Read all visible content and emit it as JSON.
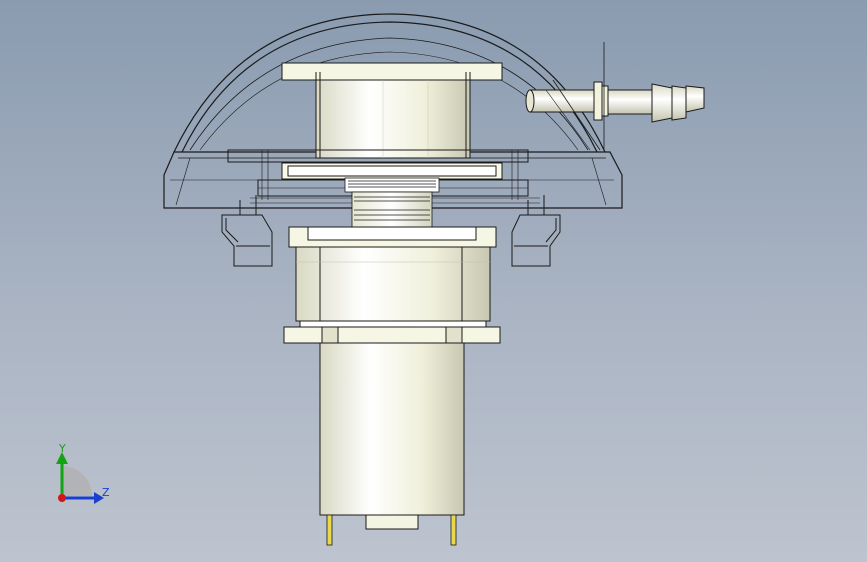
{
  "viewport": {
    "background_top": "#8a9bb0",
    "background_bottom": "#bdc4cf"
  },
  "model": {
    "view": "front",
    "render_style": "shaded-with-edges",
    "part_color": "#f4f4e2",
    "edge_color": "#1a1a1a",
    "pin_color": "#e8d84a"
  },
  "triad": {
    "icon": "coordinate-triad-icon",
    "y_label": "Y",
    "z_label": "Z",
    "y_color": "#13a313",
    "z_color": "#1a3fd0",
    "origin_color": "#d01818"
  }
}
